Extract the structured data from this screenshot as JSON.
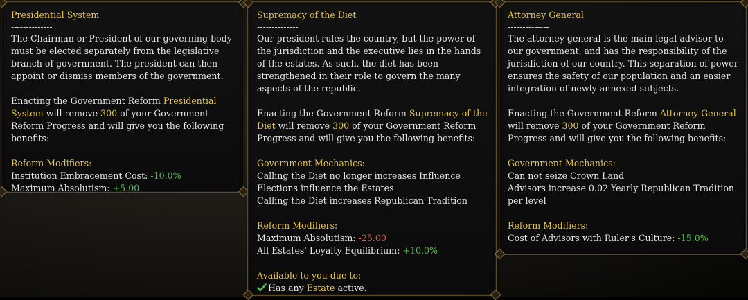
{
  "tooltips": [
    {
      "title": "Presidential System",
      "separator": "--------------",
      "description": "The Chairman or President of our governing body must be elected separately from the legislative branch of government. The president can then appoint or dismiss members of the government.",
      "enact_prefix": "Enacting the Government Reform ",
      "enact_name": "Presidential System",
      "enact_mid": " will remove ",
      "enact_cost": "300",
      "enact_suffix": " of your Government Reform Progress and will give you the following benefits:",
      "modifiers_heading": "Reform Modifiers:",
      "modifiers": [
        {
          "label": "Institution Embracement Cost: ",
          "value": "-10.0%",
          "color": "green"
        },
        {
          "label": "Maximum Absolutism: ",
          "value": "+5.00",
          "color": "green"
        }
      ]
    },
    {
      "title": "Supremacy of the Diet",
      "separator": "--------------",
      "description": "Our president rules the country, but the power of the jurisdiction and the executive lies in the hands of the estates. As such, the diet has been strengthened in their role to govern the many aspects of the republic.",
      "enact_prefix": "Enacting the Government Reform ",
      "enact_name": "Supremacy of the Diet",
      "enact_mid": " will remove ",
      "enact_cost": "300",
      "enact_suffix": " of your Government Reform Progress and will give you the following benefits:",
      "mechanics_heading": "Government Mechanics:",
      "mechanics": [
        "Calling the Diet no longer increases Influence",
        "Elections influence the Estates",
        "Calling the Diet increases Republican Tradition"
      ],
      "modifiers_heading": "Reform Modifiers:",
      "modifiers": [
        {
          "label": "Maximum Absolutism: ",
          "value": "-25.00",
          "color": "red"
        },
        {
          "label": "All Estates' Loyalty Equilibrium: ",
          "value": "+10.0%",
          "color": "green"
        }
      ],
      "available_heading": "Available to you due to:",
      "available_prefix": "Has any ",
      "available_name": "Estate",
      "available_suffix": " active."
    },
    {
      "title": "Attorney General",
      "separator": "--------------",
      "description": "The attorney general is the main legal advisor to our government, and has the responsibility of the jurisdiction of our country. This separation of power ensures the safety of our population and an easier integration of newly annexed subjects.",
      "enact_prefix": "Enacting the Government Reform ",
      "enact_name": "Attorney General",
      "enact_mid": " will remove ",
      "enact_cost": "300",
      "enact_suffix": " of your Government Reform Progress and will give you the following benefits:",
      "mechanics_heading": "Government Mechanics:",
      "mechanics": [
        "Can not seize Crown Land",
        "Advisors increase 0.02 Yearly Republican Tradition per level"
      ],
      "modifiers_heading": "Reform Modifiers:",
      "modifiers": [
        {
          "label": "Cost of Advisors with Ruler's Culture: ",
          "value": "-15.0%",
          "color": "green"
        }
      ]
    }
  ],
  "colors": {
    "gold": "#e8c548",
    "green": "#4fc24a",
    "red": "#e05a4a",
    "text": "#e6e6e6"
  },
  "icons": {
    "available_check": "check-icon"
  }
}
